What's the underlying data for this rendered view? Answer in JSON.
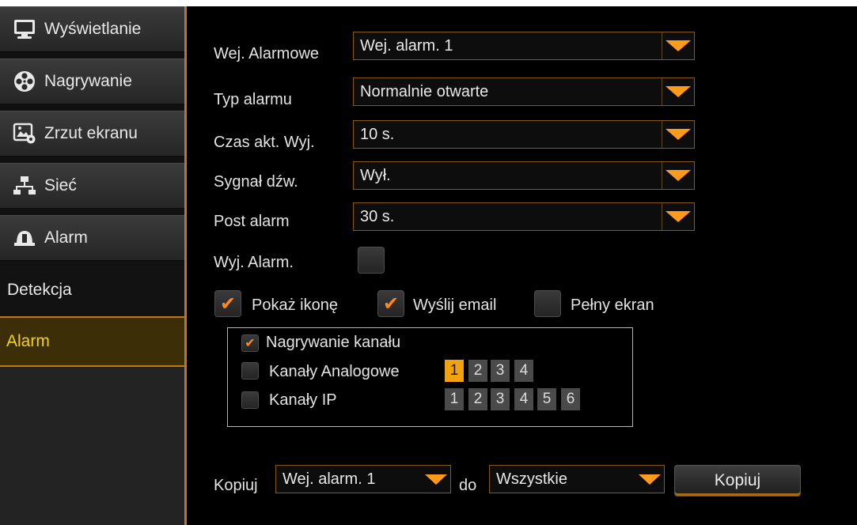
{
  "sidebar": {
    "items": [
      {
        "label": "Wyświetlanie",
        "icon": "monitor-icon"
      },
      {
        "label": "Nagrywanie",
        "icon": "film-reel-icon"
      },
      {
        "label": "Zrzut ekranu",
        "icon": "screenshot-icon"
      },
      {
        "label": "Sieć",
        "icon": "network-icon"
      },
      {
        "label": "Alarm",
        "icon": "alarm-bell-icon"
      }
    ],
    "sub_items": [
      {
        "label": "Detekcja"
      },
      {
        "label": "Alarm",
        "active": true
      }
    ]
  },
  "form": {
    "alarm_input_label": "Wej. Alarmowe",
    "alarm_input_value": "Wej. alarm. 1",
    "alarm_type_label": "Typ alarmu",
    "alarm_type_value": "Normalnie otwarte",
    "output_time_label": "Czas akt. Wyj.",
    "output_time_value": "10 s.",
    "buzzer_label": "Sygnał dźw.",
    "buzzer_value": "Wył.",
    "post_alarm_label": "Post alarm",
    "post_alarm_value": "30 s.",
    "alarm_output_label": "Wyj. Alarm.",
    "alarm_output_checked": false,
    "show_icon_label": "Pokaż ikonę",
    "show_icon_checked": true,
    "send_email_label": "Wyślij email",
    "send_email_checked": true,
    "full_screen_label": "Pełny ekran",
    "full_screen_checked": false
  },
  "recording": {
    "channel_recording_label": "Nagrywanie kanału",
    "channel_recording_checked": true,
    "analog_channels_label": "Kanały Analogowe",
    "analog_channels_checked": false,
    "analog_channels": [
      {
        "num": "1",
        "selected": true
      },
      {
        "num": "2",
        "selected": false
      },
      {
        "num": "3",
        "selected": false
      },
      {
        "num": "4",
        "selected": false
      }
    ],
    "ip_channels_label": "Kanały IP",
    "ip_channels_checked": false,
    "ip_channels": [
      {
        "num": "1",
        "selected": false
      },
      {
        "num": "2",
        "selected": false
      },
      {
        "num": "3",
        "selected": false
      },
      {
        "num": "4",
        "selected": false
      },
      {
        "num": "5",
        "selected": false
      },
      {
        "num": "6",
        "selected": false
      }
    ]
  },
  "copy": {
    "label": "Kopiuj",
    "source_value": "Wej. alarm. 1",
    "to_label": "do",
    "target_value": "Wszystkie",
    "button_label": "Kopiuj"
  },
  "colors": {
    "accent": "#ff9a1a",
    "active_text": "#f3d21a",
    "selected_channel": "#f2a20f",
    "border_accent": "#c0761c"
  }
}
